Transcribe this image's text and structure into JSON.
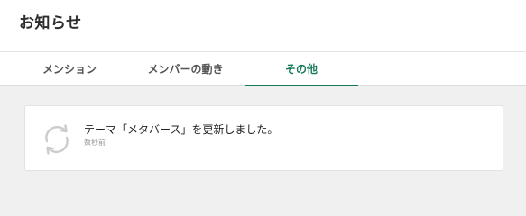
{
  "header": {
    "title": "お知らせ"
  },
  "tabs": [
    {
      "label": "メンション",
      "active": false
    },
    {
      "label": "メンバーの動き",
      "active": false
    },
    {
      "label": "その他",
      "active": true
    }
  ],
  "colors": {
    "accent": "#157a5a",
    "background": "#f0f0f0",
    "icon": "#cccccc"
  },
  "notifications": [
    {
      "icon": "refresh-icon",
      "message": "テーマ「メタバース」を更新しました。",
      "time": "数秒前"
    }
  ]
}
